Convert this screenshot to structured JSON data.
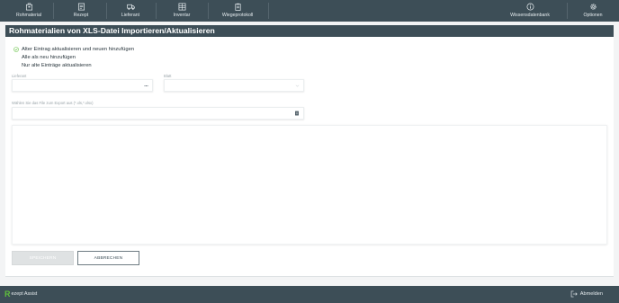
{
  "nav": {
    "items": [
      {
        "label": "Rohmaterial",
        "icon": "package-icon"
      },
      {
        "label": "Rezept",
        "icon": "recipe-icon"
      },
      {
        "label": "Lieferant",
        "icon": "truck-icon"
      },
      {
        "label": "Inventar",
        "icon": "inventory-icon"
      },
      {
        "label": "Wiegeprotokoll",
        "icon": "clipboard-icon"
      }
    ],
    "right_items": [
      {
        "label": "Wissensdatenbank",
        "icon": "info-icon"
      },
      {
        "label": "Optionen",
        "icon": "gear-icon"
      }
    ]
  },
  "page": {
    "title": "Rohmaterialien von XLS-Datei Importieren/Aktualisieren"
  },
  "import_options": [
    {
      "label": "Alter Eintrag aktualisieren und neuen hinzufügen",
      "selected": true
    },
    {
      "label": "Alle als neu hinzufügen",
      "selected": false
    },
    {
      "label": "Nur alte Einträge aktualisieren",
      "selected": false
    }
  ],
  "form": {
    "supplier_label": "Lieferant",
    "supplier_value": "",
    "sheet_label": "Blatt",
    "sheet_value": "",
    "file_label": "Wählen Sie das File zum Export aus (*.xls,*.xlsx)",
    "file_value": ""
  },
  "buttons": {
    "save_label": "SPEICHERN",
    "cancel_label": "ABBRECHEN"
  },
  "footer": {
    "logo_mark": "R",
    "logo_text": "ezept Assist",
    "logout_label": "Abmelden"
  },
  "colors": {
    "header": "#3d4e57",
    "accent_green": "#5fbf3c",
    "background": "#f3f4f5"
  }
}
